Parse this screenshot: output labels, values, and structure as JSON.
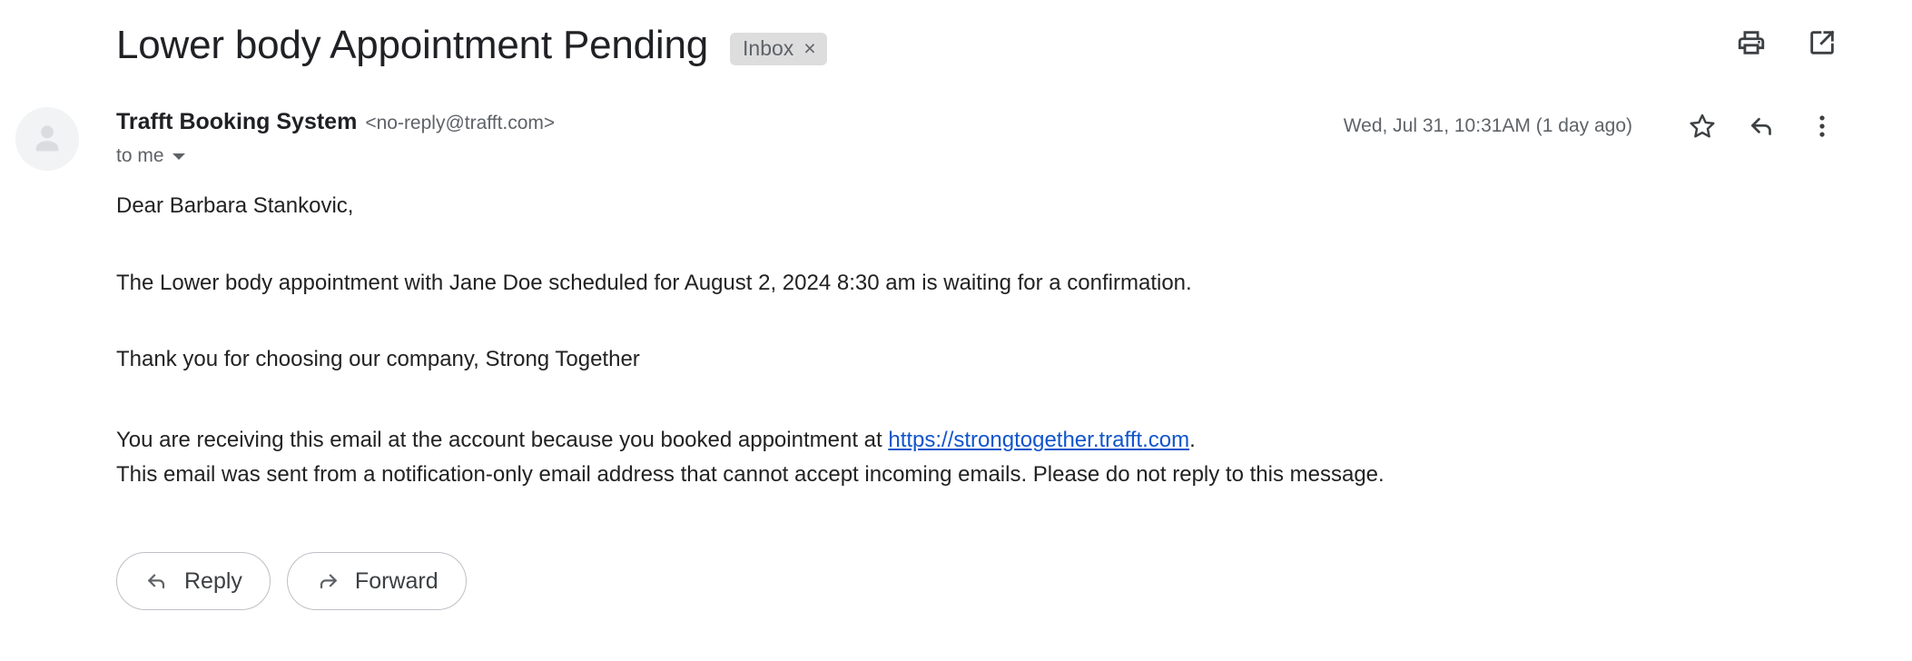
{
  "header": {
    "subject": "Lower body Appointment Pending",
    "label": {
      "text": "Inbox",
      "close_glyph": "×"
    },
    "actions": [
      {
        "name": "print-icon",
        "label": "Print all"
      },
      {
        "name": "open-in-new-window-icon",
        "label": "In new window"
      }
    ]
  },
  "message": {
    "sender_name": "Trafft Booking System",
    "sender_email": "<no-reply@trafft.com>",
    "recipients": "to me",
    "timestamp": "Wed, Jul 31, 10:31AM (1 day ago)",
    "avatar_icon": "person-placeholder-icon",
    "actions": [
      {
        "name": "star-icon",
        "label": "Star"
      },
      {
        "name": "reply-icon",
        "label": "Reply"
      },
      {
        "name": "more-options-icon",
        "label": "More"
      }
    ]
  },
  "body": {
    "greeting": "Dear Barbara Stankovic,",
    "details": "The Lower body appointment with Jane Doe scheduled for August 2, 2024 8:30 am is waiting for a confirmation.",
    "thanks": "Thank you for choosing our company, Strong Together",
    "footer_prefix": "You are receiving this email at the account because you booked appointment at ",
    "footer_link": "https://strongtogether.trafft.com",
    "footer_suffix": ".",
    "footer_notice": "This email was sent from a notification-only email address that cannot accept incoming emails. Please do not reply to this message."
  },
  "buttons": {
    "reply": "Reply",
    "forward": "Forward"
  },
  "colors": {
    "link": "#1155cc",
    "text": "#202124",
    "muted": "#5f6368",
    "chip_bg": "#ddddde",
    "avatar_bg": "#f1f3f4",
    "border": "#bdc1c6"
  }
}
